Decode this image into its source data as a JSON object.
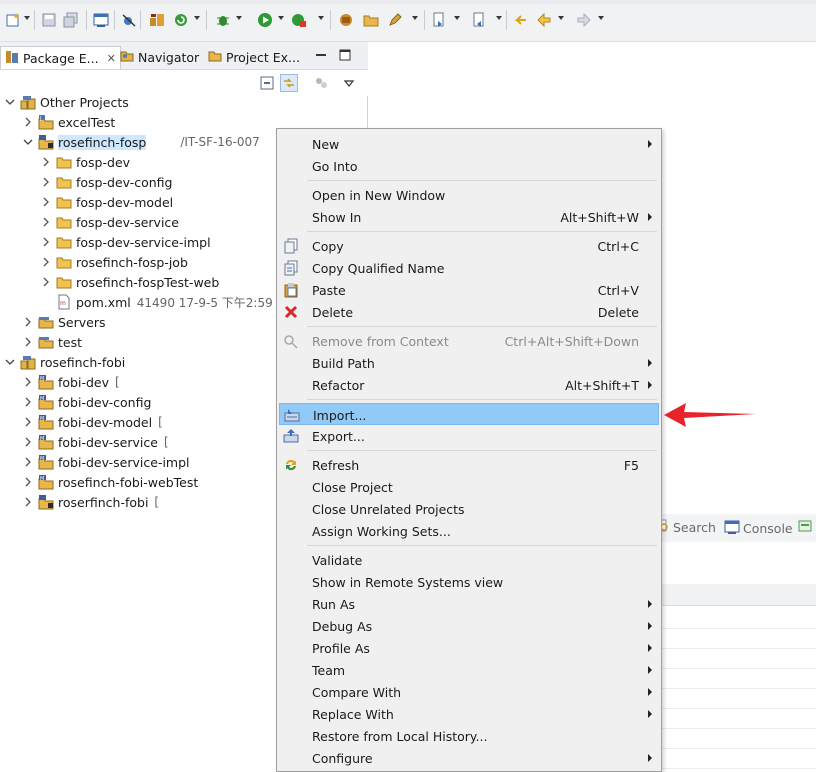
{
  "toolbar": {
    "icons": [
      "new-icon",
      "save-icon",
      "save-all-icon",
      "console-icon",
      "skip-breakpoints-icon",
      "build-icon",
      "refresh-debug-icon",
      "debug-icon",
      "run-icon",
      "run-last-icon",
      "new-package-icon",
      "open-folder-icon",
      "edit-icon",
      "next-annotation-icon",
      "prev-annotation-icon",
      "last-edit-icon",
      "back-icon",
      "forward-icon"
    ]
  },
  "view_tabs": [
    {
      "label": "Package E...",
      "active": true
    },
    {
      "label": "Navigator",
      "active": false
    },
    {
      "label": "Project Ex...",
      "active": false
    }
  ],
  "tree": [
    {
      "label": "Other Projects",
      "meta": "",
      "indent": 0,
      "expanded": true,
      "icon": "working-set-icon"
    },
    {
      "label": "excelTest",
      "meta": "",
      "indent": 1,
      "expanded": false,
      "icon": "java-project-icon"
    },
    {
      "label": "rosefinch-fosp",
      "meta": "/IT-SF-16-007",
      "indent": 1,
      "expanded": true,
      "icon": "maven-project-icon",
      "selected": true
    },
    {
      "label": "fosp-dev",
      "meta": "",
      "indent": 2,
      "expanded": false,
      "icon": "folder-icon"
    },
    {
      "label": "fosp-dev-config",
      "meta": "",
      "indent": 2,
      "expanded": false,
      "icon": "folder-icon"
    },
    {
      "label": "fosp-dev-model",
      "meta": "",
      "indent": 2,
      "expanded": false,
      "icon": "folder-icon"
    },
    {
      "label": "fosp-dev-service",
      "meta": "",
      "indent": 2,
      "expanded": false,
      "icon": "folder-icon"
    },
    {
      "label": "fosp-dev-service-impl",
      "meta": "",
      "indent": 2,
      "expanded": false,
      "icon": "folder-icon"
    },
    {
      "label": "rosefinch-fosp-job",
      "meta": "",
      "indent": 2,
      "expanded": false,
      "icon": "folder-icon"
    },
    {
      "label": "rosefinch-fospTest-web",
      "meta": "",
      "indent": 2,
      "expanded": false,
      "icon": "folder-icon"
    },
    {
      "label": "pom.xml",
      "meta": "41490  17-9-5 下午2:59",
      "indent": 2,
      "expanded": null,
      "icon": "xml-file-icon"
    },
    {
      "label": "Servers",
      "meta": "",
      "indent": 1,
      "expanded": false,
      "icon": "project-folder-icon"
    },
    {
      "label": "test",
      "meta": "",
      "indent": 1,
      "expanded": false,
      "icon": "project-folder-icon"
    },
    {
      "label": "rosefinch-fobi",
      "meta": "",
      "indent": 0,
      "expanded": true,
      "icon": "working-set-icon"
    },
    {
      "label": "fobi-dev",
      "meta": "[",
      "indent": 1,
      "expanded": false,
      "icon": "maven-module-icon"
    },
    {
      "label": "fobi-dev-config",
      "meta": "",
      "indent": 1,
      "expanded": false,
      "icon": "maven-module-icon"
    },
    {
      "label": "fobi-dev-model",
      "meta": "[",
      "indent": 1,
      "expanded": false,
      "icon": "maven-module-icon"
    },
    {
      "label": "fobi-dev-service",
      "meta": "[",
      "indent": 1,
      "expanded": false,
      "icon": "maven-module-icon"
    },
    {
      "label": "fobi-dev-service-impl",
      "meta": "",
      "indent": 1,
      "expanded": false,
      "icon": "maven-module-icon"
    },
    {
      "label": "rosefinch-fobi-webTest",
      "meta": "",
      "indent": 1,
      "expanded": false,
      "icon": "maven-module-icon"
    },
    {
      "label": "roserfinch-fobi",
      "meta": "[",
      "indent": 1,
      "expanded": false,
      "icon": "maven-project-icon"
    }
  ],
  "context_menu": {
    "items": [
      {
        "type": "item",
        "label": "New",
        "shortcut": "",
        "submenu": true,
        "icon": ""
      },
      {
        "type": "item",
        "label": "Go Into",
        "shortcut": "",
        "submenu": false,
        "icon": ""
      },
      {
        "type": "sep"
      },
      {
        "type": "item",
        "label": "Open in New Window",
        "shortcut": "",
        "submenu": false,
        "icon": ""
      },
      {
        "type": "item",
        "label": "Show In",
        "shortcut": "Alt+Shift+W",
        "submenu": true,
        "icon": ""
      },
      {
        "type": "sep"
      },
      {
        "type": "item",
        "label": "Copy",
        "shortcut": "Ctrl+C",
        "submenu": false,
        "icon": "copy-icon"
      },
      {
        "type": "item",
        "label": "Copy Qualified Name",
        "shortcut": "",
        "submenu": false,
        "icon": "copy-qualified-icon"
      },
      {
        "type": "item",
        "label": "Paste",
        "shortcut": "Ctrl+V",
        "submenu": false,
        "icon": "paste-icon"
      },
      {
        "type": "item",
        "label": "Delete",
        "shortcut": "Delete",
        "submenu": false,
        "icon": "delete-icon"
      },
      {
        "type": "sep"
      },
      {
        "type": "item",
        "label": "Remove from Context",
        "shortcut": "Ctrl+Alt+Shift+Down",
        "submenu": false,
        "icon": "remove-context-icon",
        "disabled": true
      },
      {
        "type": "item",
        "label": "Build Path",
        "shortcut": "",
        "submenu": true,
        "icon": ""
      },
      {
        "type": "item",
        "label": "Refactor",
        "shortcut": "Alt+Shift+T",
        "submenu": true,
        "icon": ""
      },
      {
        "type": "sep"
      },
      {
        "type": "item",
        "label": "Import...",
        "shortcut": "",
        "submenu": false,
        "icon": "import-icon",
        "highlight": true
      },
      {
        "type": "item",
        "label": "Export...",
        "shortcut": "",
        "submenu": false,
        "icon": "export-icon"
      },
      {
        "type": "sep"
      },
      {
        "type": "item",
        "label": "Refresh",
        "shortcut": "F5",
        "submenu": false,
        "icon": "refresh-icon"
      },
      {
        "type": "item",
        "label": "Close Project",
        "shortcut": "",
        "submenu": false,
        "icon": ""
      },
      {
        "type": "item",
        "label": "Close Unrelated Projects",
        "shortcut": "",
        "submenu": false,
        "icon": ""
      },
      {
        "type": "item",
        "label": "Assign Working Sets...",
        "shortcut": "",
        "submenu": false,
        "icon": ""
      },
      {
        "type": "sep"
      },
      {
        "type": "item",
        "label": "Validate",
        "shortcut": "",
        "submenu": false,
        "icon": ""
      },
      {
        "type": "item",
        "label": "Show in Remote Systems view",
        "shortcut": "",
        "submenu": false,
        "icon": ""
      },
      {
        "type": "item",
        "label": "Run As",
        "shortcut": "",
        "submenu": true,
        "icon": ""
      },
      {
        "type": "item",
        "label": "Debug As",
        "shortcut": "",
        "submenu": true,
        "icon": ""
      },
      {
        "type": "item",
        "label": "Profile As",
        "shortcut": "",
        "submenu": true,
        "icon": ""
      },
      {
        "type": "item",
        "label": "Team",
        "shortcut": "",
        "submenu": true,
        "icon": ""
      },
      {
        "type": "item",
        "label": "Compare With",
        "shortcut": "",
        "submenu": true,
        "icon": ""
      },
      {
        "type": "item",
        "label": "Replace With",
        "shortcut": "",
        "submenu": true,
        "icon": ""
      },
      {
        "type": "item",
        "label": "Restore from Local History...",
        "shortcut": "",
        "submenu": false,
        "icon": ""
      },
      {
        "type": "item",
        "label": "Configure",
        "shortcut": "",
        "submenu": true,
        "icon": ""
      }
    ]
  },
  "bottom_tabs": [
    {
      "label": "Search",
      "icon": "search-icon"
    },
    {
      "label": "Console",
      "icon": "console-icon"
    }
  ],
  "colors": {
    "selection": "#cde8ff",
    "menu_highlight": "#91c9f7",
    "annotation_arrow": "#e8242a"
  }
}
